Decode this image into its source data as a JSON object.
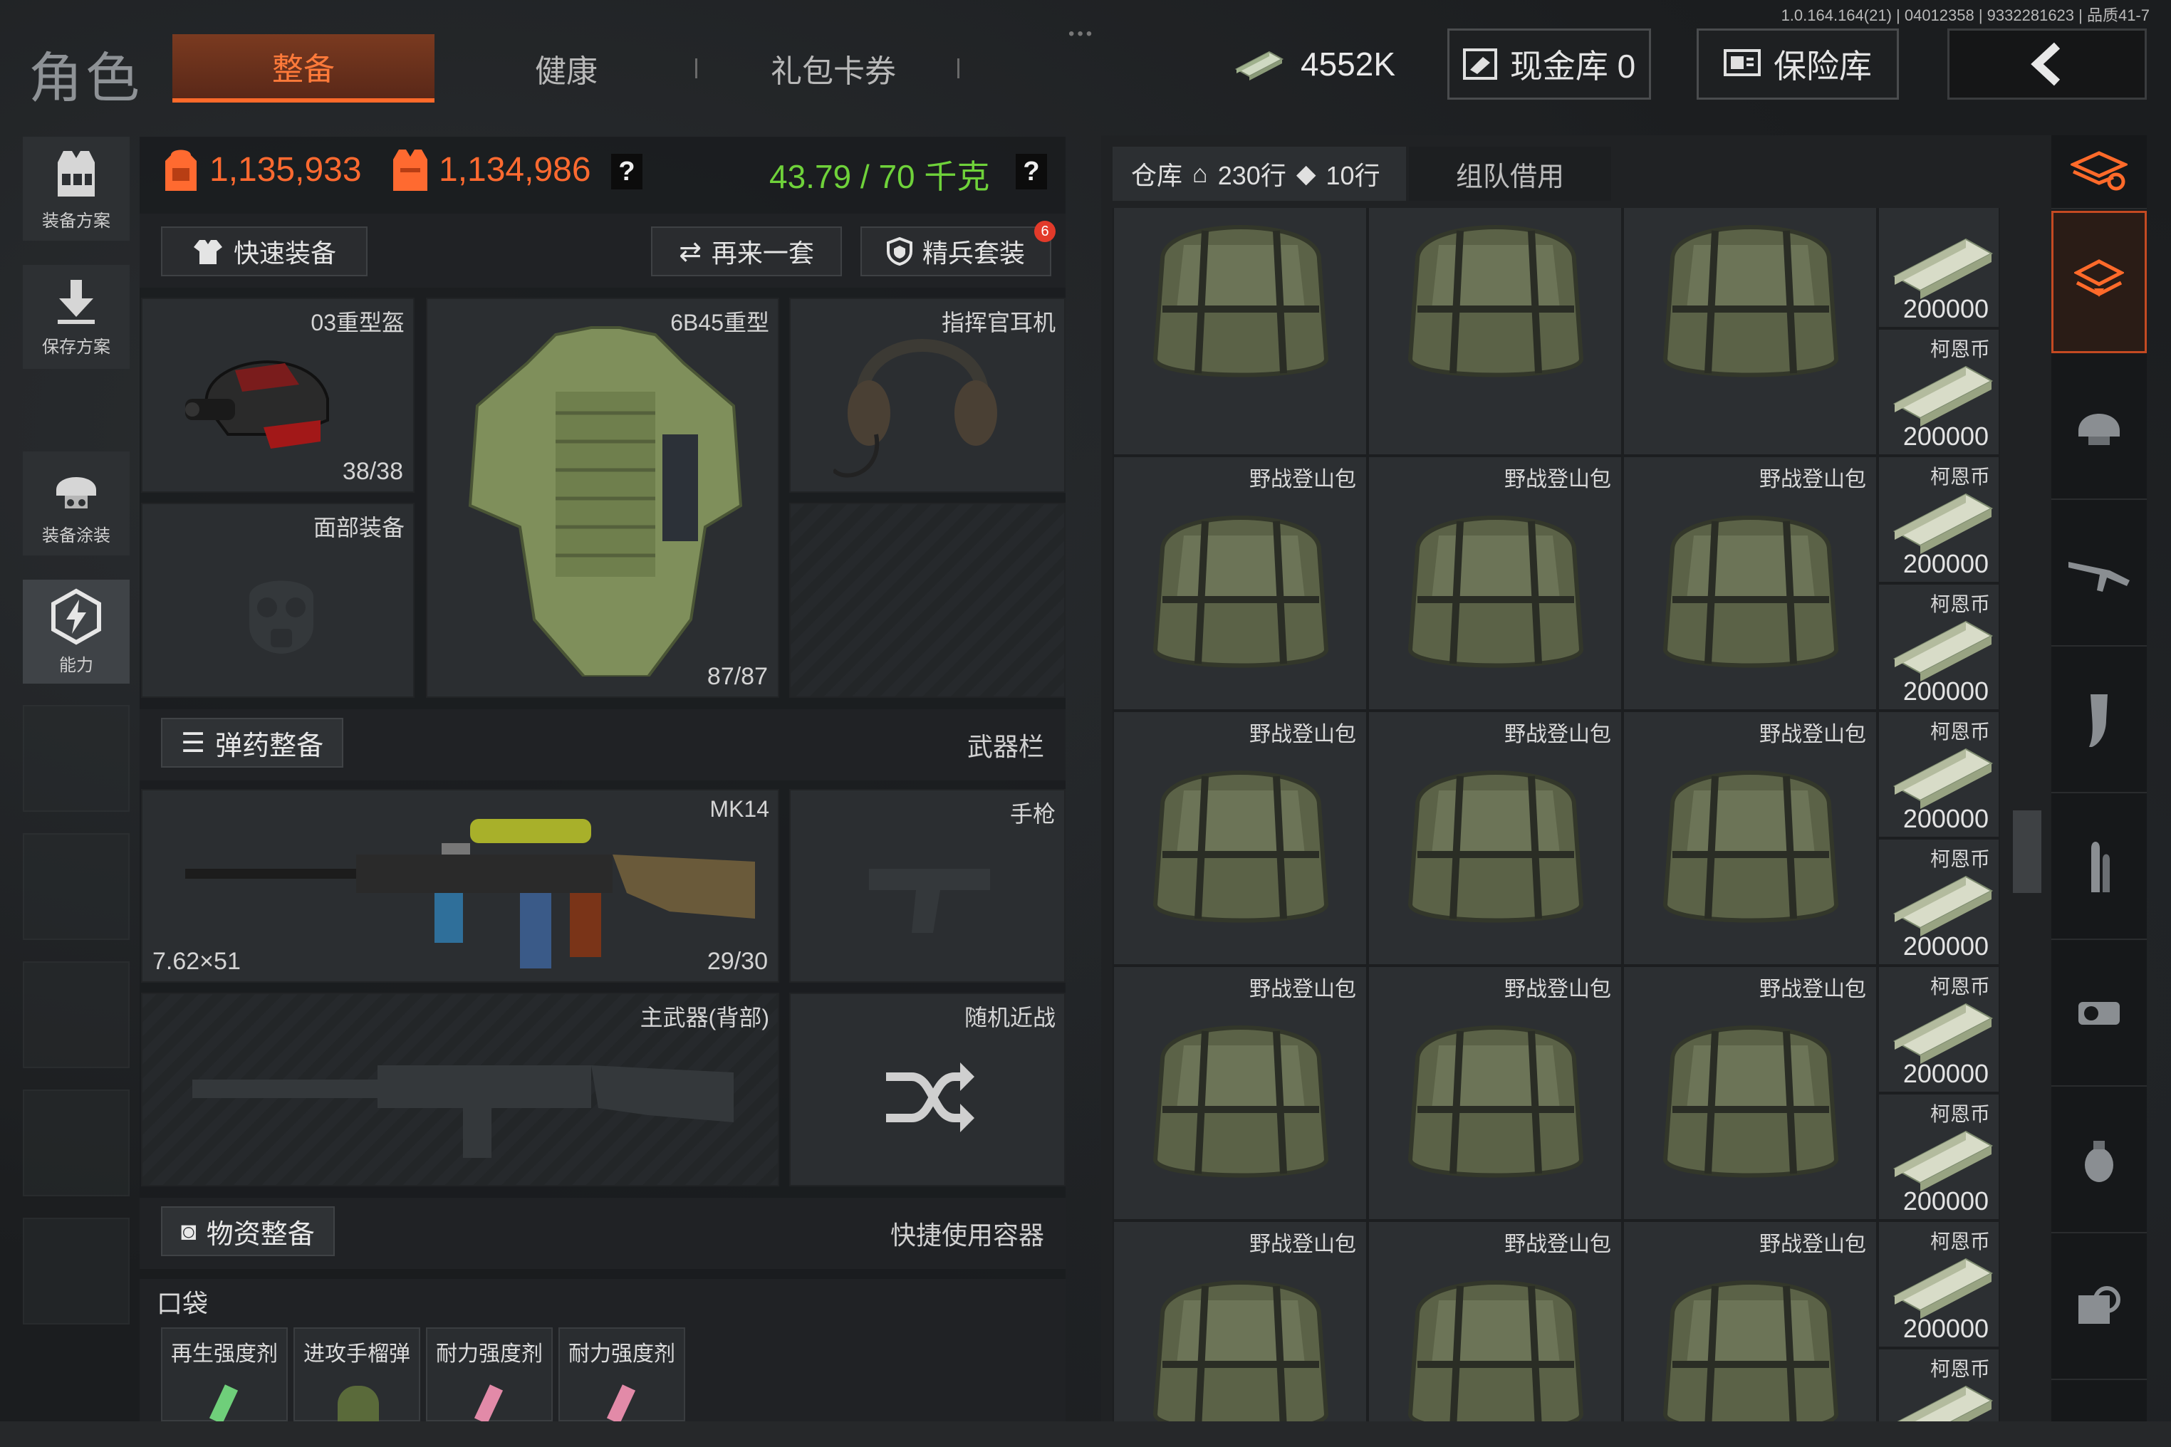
{
  "header": {
    "version": "1.0.164.164(21) | 04012358 | 9332281623 | 品质41-7",
    "title": "角色",
    "tabs": [
      {
        "label": "整备",
        "active": true
      },
      {
        "label": "健康",
        "active": false
      },
      {
        "label": "礼包卡券",
        "active": false
      }
    ],
    "currency": "4552K",
    "cash_vault": "现金库 0",
    "safe": "保险库"
  },
  "sidebar": {
    "items": [
      {
        "label": "装备方案",
        "icon": "vest-icon"
      },
      {
        "label": "保存方案",
        "icon": "download-icon"
      },
      {
        "label": "装备涂装",
        "icon": "helmet-icon"
      },
      {
        "label": "能力",
        "icon": "ability-icon",
        "active": true
      }
    ]
  },
  "stats": {
    "value1": "1,135,933",
    "value2": "1,134,986",
    "weight": "43.79 / 70 千克",
    "help": "?"
  },
  "actions": {
    "quick_equip": "快速装备",
    "again": "再来一套",
    "elite": "精兵套装",
    "elite_badge": "6"
  },
  "gear": {
    "helmet": {
      "name": "03重型盔",
      "durability": "38/38"
    },
    "armor": {
      "name": "6B45重型",
      "durability": "87/87"
    },
    "headset": {
      "name": "指挥官耳机"
    },
    "face": {
      "name": "面部装备"
    }
  },
  "ammo_section": {
    "button": "弹药整备",
    "right": "武器栏"
  },
  "weapons": {
    "primary": {
      "name": "MK14",
      "caliber": "7.62×51",
      "ammo": "29/30"
    },
    "pistol": {
      "name": "手枪"
    },
    "back": {
      "name": "主武器(背部)"
    },
    "melee": {
      "name": "随机近战"
    }
  },
  "supply_section": {
    "button": "物资整备",
    "right": "快捷使用容器"
  },
  "pocket": {
    "label": "口袋",
    "items": [
      "再生强度剂",
      "进攻手榴弹",
      "耐力强度剂",
      "耐力强度剂"
    ]
  },
  "storage": {
    "label": "仓库",
    "rows": "230行",
    "rows2": "10行",
    "team_tab": "组队借用",
    "bag_name": "野战登山包",
    "cash_name": "柯恩币",
    "cash_value": "200000"
  },
  "colors": {
    "accent": "#ff6a2a",
    "weight": "#6fd23a",
    "value": "#ff6a30"
  }
}
